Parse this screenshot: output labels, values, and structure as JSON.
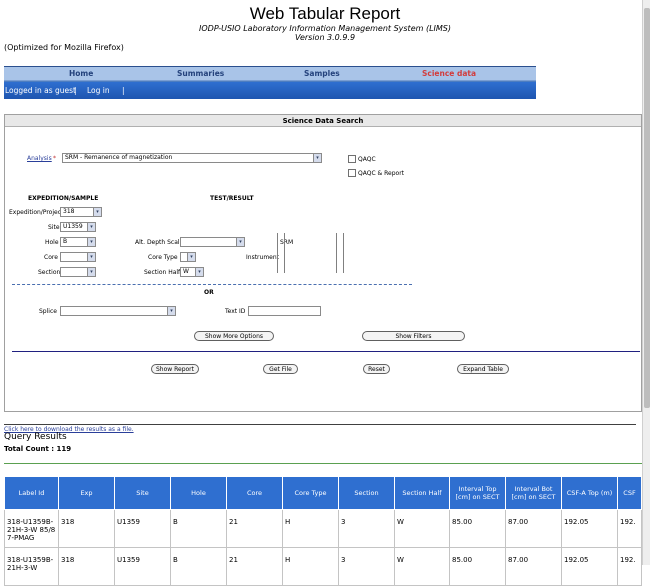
{
  "header": {
    "title": "Web Tabular Report",
    "subtitle": "IODP-USIO Laboratory Information Management System (LIMS)",
    "version": "Version 3.0.9.9",
    "optimized": "(Optimized for Mozilla Firefox)"
  },
  "nav": {
    "items": [
      {
        "label": "Home"
      },
      {
        "label": "Summaries"
      },
      {
        "label": "Samples"
      },
      {
        "label": "Science data",
        "active": true
      }
    ],
    "logged_in": "Logged in as guest",
    "login": "Log in",
    "sep": "|"
  },
  "search": {
    "title": "Science Data Search",
    "analysis_label": "Analysis",
    "analysis_star": "*",
    "analysis_value": "SRM - Remanence of magnetization",
    "qaqc": "QAQC",
    "qaqc_report": "QAQC & Report",
    "expedition_section": "EXPEDITION/SAMPLE",
    "test_section": "TEST/RESULT",
    "expedition_label": "Expedition/Project",
    "expedition_value": "318",
    "site_label": "Site",
    "site_value": "U1359",
    "hole_label": "Hole",
    "hole_value": "B",
    "core_label": "Core",
    "section_label": "Section",
    "alt_depth_label": "Alt. Depth Scale",
    "core_type_label": "Core Type",
    "section_half_label": "Section Half",
    "section_half_value": "W",
    "instrument_label": "Instrument",
    "instrument_value": "SRM",
    "or_label": "OR",
    "splice_label": "Splice",
    "text_id_label": "Text ID",
    "show_more": "Show More Options",
    "show_filters": "Show Filters",
    "show_report": "Show Report",
    "get_file": "Get File",
    "reset": "Reset",
    "expand_table": "Expand Table"
  },
  "results": {
    "download": "Click here to download the results as a file.",
    "heading": "Query Results",
    "total_count": "Total Count : 119",
    "columns": [
      "Label Id",
      "Exp",
      "Site",
      "Hole",
      "Core",
      "Core Type",
      "Section",
      "Section Half",
      "Interval Top [cm] on SECT",
      "Interval Bot [cm] on SECT",
      "CSF-A Top (m)",
      "CSF"
    ],
    "rows": [
      [
        "318-U1359B-21H-3-W 85/87-PMAG",
        "318",
        "U1359",
        "B",
        "21",
        "H",
        "3",
        "W",
        "85.00",
        "87.00",
        "192.05",
        "192."
      ],
      [
        "318-U1359B-21H-3-W",
        "318",
        "U1359",
        "B",
        "21",
        "H",
        "3",
        "W",
        "85.00",
        "87.00",
        "192.05",
        "192."
      ]
    ]
  }
}
